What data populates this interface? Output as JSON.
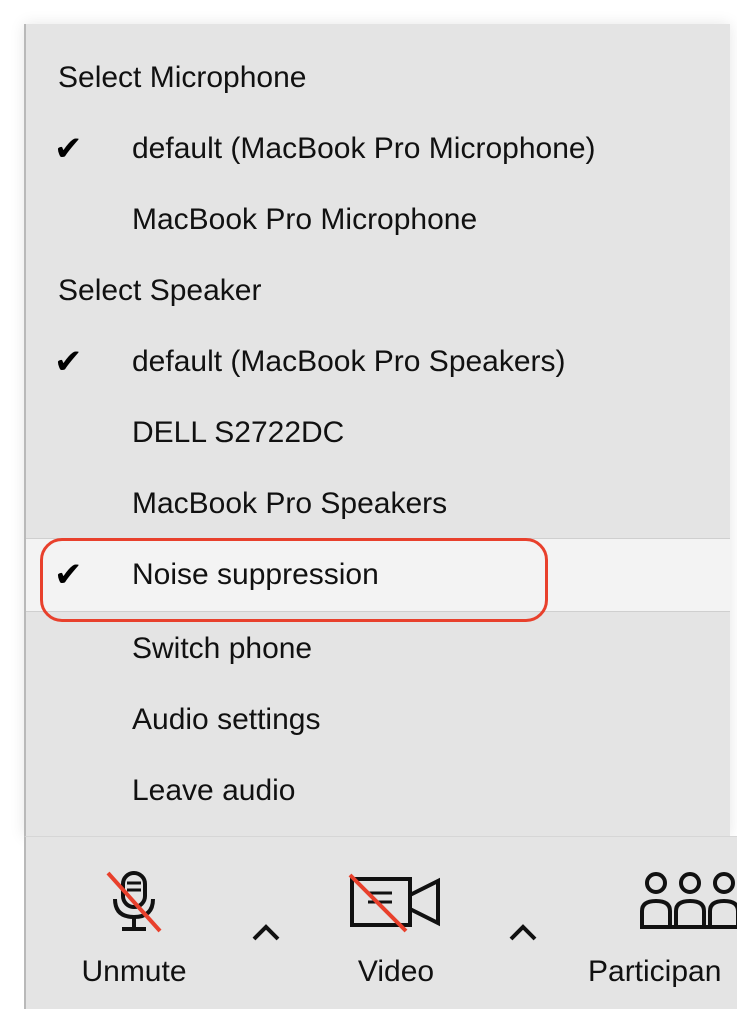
{
  "menu": {
    "sections": {
      "microphone_header": "Select Microphone",
      "speaker_header": "Select Speaker"
    },
    "microphones": [
      {
        "label": "default (MacBook Pro Microphone)",
        "checked": true
      },
      {
        "label": "MacBook Pro Microphone",
        "checked": false
      }
    ],
    "speakers": [
      {
        "label": "default (MacBook Pro Speakers)",
        "checked": true
      },
      {
        "label": "DELL S2722DC",
        "checked": false
      },
      {
        "label": "MacBook Pro Speakers",
        "checked": false
      }
    ],
    "noise_suppression": {
      "label": "Noise suppression",
      "checked": true
    },
    "actions": {
      "switch_phone": "Switch phone",
      "audio_settings": "Audio settings",
      "leave_audio": "Leave audio"
    },
    "check_glyph": "✔"
  },
  "toolbar": {
    "unmute_label": "Unmute",
    "video_label": "Video",
    "participants_label": "Participan"
  },
  "icons": {
    "check": "checkmark-icon",
    "mic": "microphone-muted-icon",
    "video": "video-off-icon",
    "participants": "participants-icon",
    "caret": "chevron-up-icon"
  },
  "colors": {
    "highlight_ring": "#e8402c",
    "strike_red": "#e8402c",
    "panel_bg": "#e4e4e4"
  }
}
